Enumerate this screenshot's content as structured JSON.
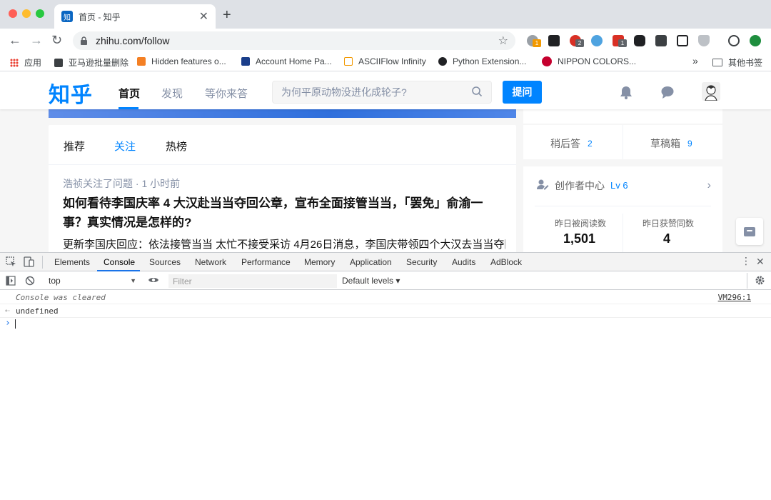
{
  "browser": {
    "tab_title": "首页 - 知乎",
    "tab_favicon_text": "知",
    "url": "zhihu.com/follow",
    "extension_badges": [
      "1",
      "2",
      "1"
    ]
  },
  "bookmarks": {
    "items": [
      "应用",
      "亚马逊批量删除",
      "Hidden features o...",
      "Account Home Pa...",
      "ASCIIFlow Infinity",
      "Python Extension...",
      "NIPPON COLORS..."
    ],
    "overflow": "»",
    "other": "其他书签"
  },
  "zhihu": {
    "logo": "知乎",
    "nav": [
      "首页",
      "发现",
      "等你来答"
    ],
    "search_placeholder": "为何平原动物没进化成轮子?",
    "ask_button": "提问",
    "feed_tabs": [
      "推荐",
      "关注",
      "热榜"
    ],
    "feed_item": {
      "meta": "浩祯关注了问题 · 1 小时前",
      "title": "如何看待李国庆率 4 大汉赴当当夺回公章，宣布全面接管当当，「罢免」俞渝一事？真实情况是怎样的?",
      "excerpt": "更新李国庆回应：依法接管当当 太忙不接受采访 4月26日消息，李国庆带领四个大汉去当当夺回公"
    },
    "sidebar": {
      "answer_later_label": "稍后答",
      "answer_later_count": "2",
      "drafts_label": "草稿箱",
      "drafts_count": "9",
      "creator_center": "创作者中心",
      "level": "Lv 6",
      "stats": [
        {
          "label": "昨日被阅读数",
          "value": "1,501"
        },
        {
          "label": "昨日获赞同数",
          "value": "4"
        }
      ]
    }
  },
  "devtools": {
    "tabs": [
      "Elements",
      "Console",
      "Sources",
      "Network",
      "Performance",
      "Memory",
      "Application",
      "Security",
      "Audits",
      "AdBlock"
    ],
    "context": "top",
    "filter_placeholder": "Filter",
    "levels": "Default levels ▾",
    "console_lines": [
      {
        "text": "Console was cleared",
        "source": "VM296:1"
      },
      {
        "text": "undefined"
      }
    ],
    "prompt": "›"
  },
  "colors": {
    "zhihu_blue": "#0084ff",
    "devtools_accent": "#1a73e8"
  }
}
